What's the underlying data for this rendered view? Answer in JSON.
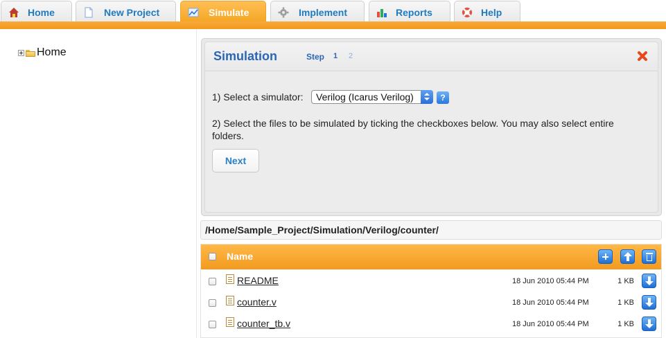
{
  "tabs": [
    {
      "label": "Home",
      "icon": "home-icon",
      "active": false
    },
    {
      "label": "New Project",
      "icon": "document-icon",
      "active": false
    },
    {
      "label": "Simulate",
      "icon": "chart-icon",
      "active": true
    },
    {
      "label": "Implement",
      "icon": "gear-icon",
      "active": false
    },
    {
      "label": "Reports",
      "icon": "bar-chart-icon",
      "active": false
    },
    {
      "label": "Help",
      "icon": "lifebuoy-icon",
      "active": false
    }
  ],
  "sidebar": {
    "tree_root": "Home"
  },
  "panel": {
    "title": "Simulation",
    "step_label": "Step",
    "steps": [
      "1",
      "2"
    ],
    "simulator_prompt": "1) Select a simulator:",
    "simulator_selected": "Verilog (Icarus Verilog)",
    "help_label": "?",
    "files_instruction": "2) Select the files to be simulated by ticking the checkboxes below. You may also select entire folders.",
    "next_label": "Next"
  },
  "path": "/Home/Sample_Project/Simulation/Verilog/counter/",
  "file_table": {
    "header_name": "Name",
    "rows": [
      {
        "name": "README",
        "date": "18 Jun 2010 05:44 PM",
        "size": "1 KB"
      },
      {
        "name": "counter.v",
        "date": "18 Jun 2010 05:44 PM",
        "size": "1 KB"
      },
      {
        "name": "counter_tb.v",
        "date": "18 Jun 2010 05:44 PM",
        "size": "1 KB"
      }
    ]
  },
  "colors": {
    "accent_orange": "#f39a1f",
    "link_blue": "#1f7bc0",
    "title_blue": "#2a66b6",
    "close_red": "#e44a1c"
  }
}
